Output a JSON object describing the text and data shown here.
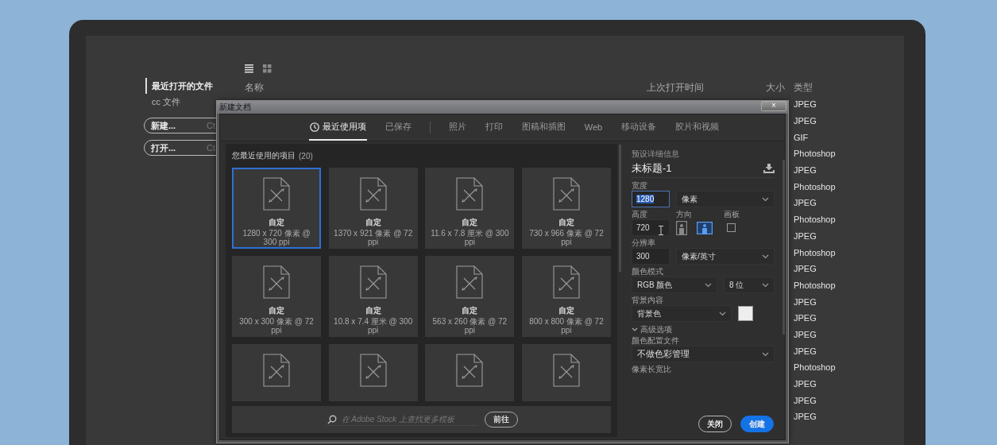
{
  "sidebar": {
    "items": [
      {
        "label": "最近打开的文件",
        "selected": true
      },
      {
        "label": "cc 文件",
        "selected": false
      }
    ],
    "buttons": [
      {
        "label": "新建...",
        "shortcut": "Ct"
      },
      {
        "label": "打开...",
        "shortcut": "Ct"
      }
    ]
  },
  "toolbar": {
    "views": [
      {
        "kind": "list",
        "selected": true
      },
      {
        "kind": "grid",
        "selected": false
      }
    ]
  },
  "file_list": {
    "columns": [
      "名称",
      "上次打开时间",
      "大小",
      "类型"
    ],
    "rows": [
      {
        "type": "JPEG"
      },
      {
        "type": "JPEG"
      },
      {
        "type": "GIF"
      },
      {
        "type": "Photoshop"
      },
      {
        "type": "JPEG"
      },
      {
        "type": "Photoshop"
      },
      {
        "type": "JPEG"
      },
      {
        "type": "Photoshop"
      },
      {
        "type": "JPEG"
      },
      {
        "type": "Photoshop"
      },
      {
        "type": "JPEG"
      },
      {
        "type": "Photoshop"
      },
      {
        "type": "JPEG"
      },
      {
        "type": "JPEG"
      },
      {
        "type": "JPEG"
      },
      {
        "type": "JPEG"
      },
      {
        "type": "Photoshop"
      },
      {
        "type": "JPEG"
      },
      {
        "type": "JPEG"
      },
      {
        "type": "JPEG"
      }
    ]
  },
  "dialog": {
    "title": "新建文档",
    "close": "×",
    "tab_groups": [
      [
        {
          "label": "最近使用项",
          "selected": true,
          "kind": "recent"
        },
        {
          "label": "已保存",
          "selected": false,
          "kind": "plain"
        }
      ],
      [
        {
          "label": "照片",
          "selected": false,
          "kind": "plain"
        },
        {
          "label": "打印",
          "selected": false,
          "kind": "plain"
        },
        {
          "label": "图稿和插图",
          "selected": false,
          "kind": "plain"
        },
        {
          "label": "Web",
          "selected": false,
          "kind": "plain"
        },
        {
          "label": "移动设备",
          "selected": false,
          "kind": "plain"
        },
        {
          "label": "胶片和视频",
          "selected": false,
          "kind": "plain"
        }
      ]
    ],
    "recent": {
      "heading": "您最近使用的项目",
      "count": "(20)",
      "presets": [
        {
          "name": "自定",
          "detail": "1280 x 720 像素 @ 300 ppi",
          "selected": true
        },
        {
          "name": "自定",
          "detail": "1370 x 921 像素 @ 72 ppi",
          "selected": false
        },
        {
          "name": "自定",
          "detail": "11.6 x 7.8 厘米 @ 300 ppi",
          "selected": false
        },
        {
          "name": "自定",
          "detail": "730 x 966 像素 @ 72 ppi",
          "selected": false
        },
        {
          "name": "自定",
          "detail": "300 x 300 像素 @ 72 ppi",
          "selected": false
        },
        {
          "name": "自定",
          "detail": "10.8 x 7.4 厘米 @ 300 ppi",
          "selected": false
        },
        {
          "name": "自定",
          "detail": "563 x 260 像素 @ 72 ppi",
          "selected": false
        },
        {
          "name": "自定",
          "detail": "800 x 800 像素 @ 72 ppi",
          "selected": false
        },
        {
          "selected": false
        },
        {
          "selected": false
        },
        {
          "selected": false
        },
        {
          "selected": false
        }
      ]
    },
    "stock_search": {
      "placeholder": "在 Adobe Stock 上查找更多模板",
      "button": "前往"
    },
    "details": {
      "heading": "预设详细信息",
      "doc_name": "未标题-1",
      "width": {
        "label": "宽度",
        "value": "1280",
        "value_selected": true,
        "unit": "像素"
      },
      "height": {
        "label": "高度",
        "value": "720"
      },
      "orientation": {
        "label": "方向",
        "options": [
          {
            "kind": "portrait",
            "selected": false
          },
          {
            "kind": "landscape",
            "selected": true
          }
        ]
      },
      "artboard": {
        "label": "画板",
        "checked": false
      },
      "resolution": {
        "label": "分辨率",
        "value": "300",
        "unit": "像素/英寸"
      },
      "color_mode": {
        "label": "颜色模式",
        "mode": "RGB 颜色",
        "depth": "8 位"
      },
      "background": {
        "label": "背景内容",
        "value": "背景色"
      },
      "advanced": {
        "label": "高级选项",
        "expanded": true
      },
      "color_profile": {
        "label": "颜色配置文件",
        "value": "不做色彩管理"
      },
      "pixel_aspect": {
        "label": "像素长宽比"
      },
      "buttons": [
        {
          "label": "关闭",
          "kind": "secondary"
        },
        {
          "label": "创建",
          "kind": "primary"
        }
      ]
    }
  }
}
